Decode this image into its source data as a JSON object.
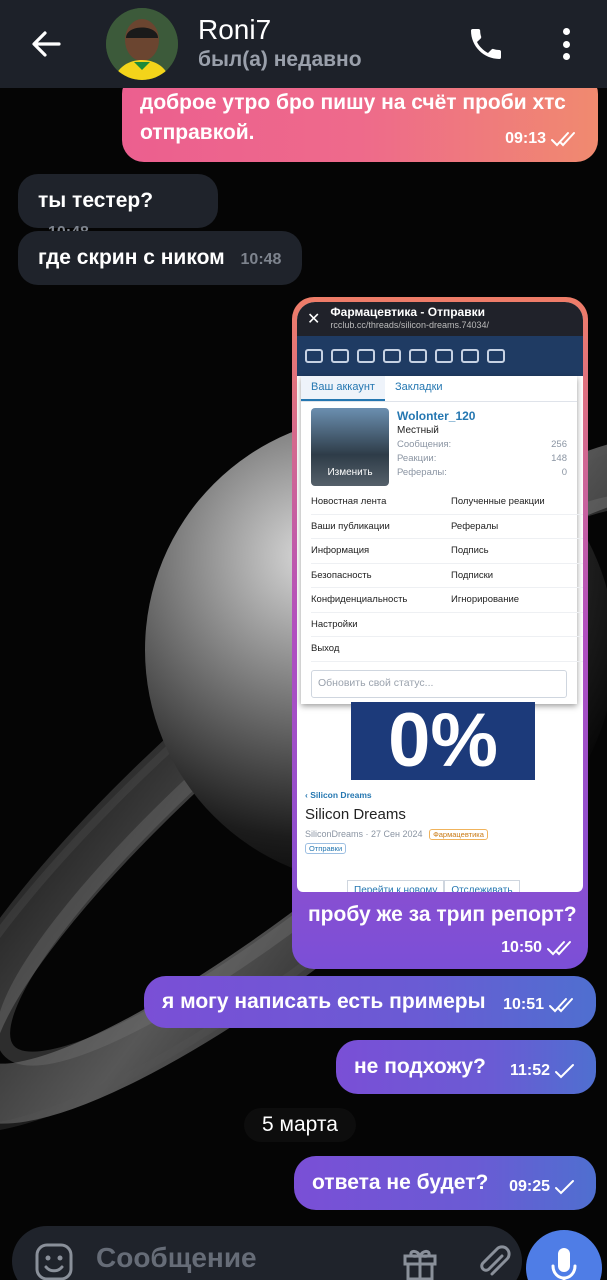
{
  "header": {
    "contact_name": "Roni7",
    "last_seen": "был(а) недавно"
  },
  "messages": [
    {
      "dir": "out",
      "text": "доброе утро бро пишу на счёт проби хтс отправкой.",
      "time": "09:13",
      "read": true
    },
    {
      "dir": "in",
      "text": "ты тестер?",
      "time": "10:48"
    },
    {
      "dir": "in",
      "text": "где скрин с ником",
      "time": "10:48"
    },
    {
      "dir": "out",
      "text": "пробу же за трип репорт?",
      "time": "10:50",
      "read": true,
      "has_image": true
    },
    {
      "dir": "out",
      "text": "я могу написать есть примеры",
      "time": "10:51",
      "read": true
    },
    {
      "dir": "out",
      "text": "не подхожу?",
      "time": "11:52",
      "read": false
    },
    {
      "dir": "out",
      "text": "ответа не будет?",
      "time": "09:25",
      "read": false
    }
  ],
  "date_separator": "5 марта",
  "screenshot": {
    "browser_title": "Фармацевтика - Отправки",
    "browser_url": "rcclub.cc/threads/silicon-dreams.74034/",
    "tabs": [
      "Ваш аккаунт",
      "Закладки"
    ],
    "username": "Wolonter_120",
    "rank": "Местный",
    "change_label": "Изменить",
    "stats": [
      {
        "label": "Сообщения:",
        "value": "256"
      },
      {
        "label": "Реакции:",
        "value": "148"
      },
      {
        "label": "Рефералы:",
        "value": "0"
      }
    ],
    "links": [
      "Новостная лента",
      "Полученные реакции",
      "Ваши публикации",
      "Рефералы",
      "Информация",
      "Подпись",
      "Безопасность",
      "Подписки",
      "Конфиденциальность",
      "Игнорирование",
      "Настройки",
      "",
      "Выход",
      ""
    ],
    "status_placeholder": "Обновить свой статус...",
    "banner_text": "0%",
    "breadcrumb": "Silicon Dreams",
    "thread_title": "Silicon Dreams",
    "thread_author": "SiliconDreams",
    "thread_date": "27 Сен 2024",
    "tag_category": "Фармацевтика",
    "tag_prefix": "Отправки",
    "btn_go_new": "Перейти к новому",
    "btn_watch": "Отслеживать"
  },
  "composer": {
    "placeholder": "Сообщение"
  },
  "colors": {
    "header_bg": "#1d2129",
    "incoming_bg": "#1f232b",
    "outgoing_purple": "#6a5bd4",
    "outgoing_pink": "#ec5f8f",
    "mic_button": "#4f7de6"
  },
  "icons": [
    "back-arrow-icon",
    "phone-icon",
    "more-vertical-icon",
    "double-check-icon",
    "check-icon",
    "emoji-icon",
    "gift-icon",
    "paperclip-icon",
    "microphone-icon"
  ]
}
